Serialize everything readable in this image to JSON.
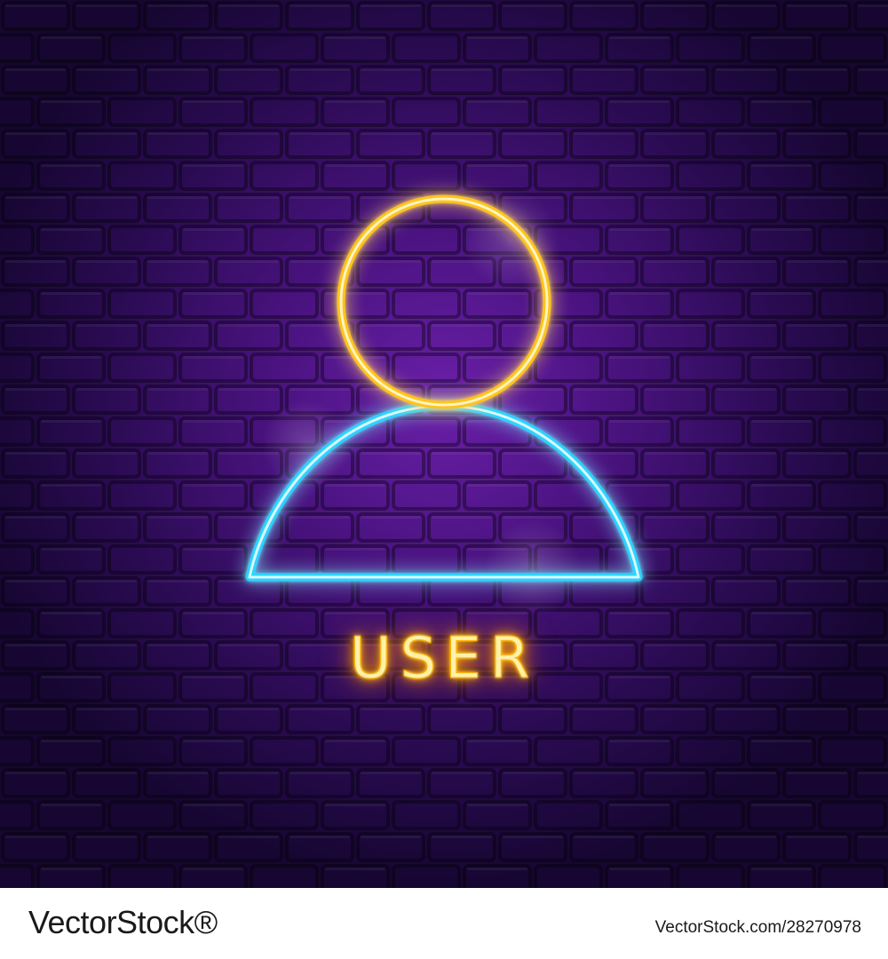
{
  "image": {
    "caption": "USER",
    "palette": {
      "wall": "#1a0838",
      "wall_glow": "#6a1fa8",
      "head_neon": "#ffc41a",
      "body_neon": "#2ad4ff",
      "caption_neon": "#ffb000"
    },
    "icons": {
      "head": "circle-head-icon",
      "body": "half-dome-body-icon"
    }
  },
  "footer": {
    "logo_text": "VectorStock®",
    "image_id": "VectorStock.com/28270978"
  }
}
